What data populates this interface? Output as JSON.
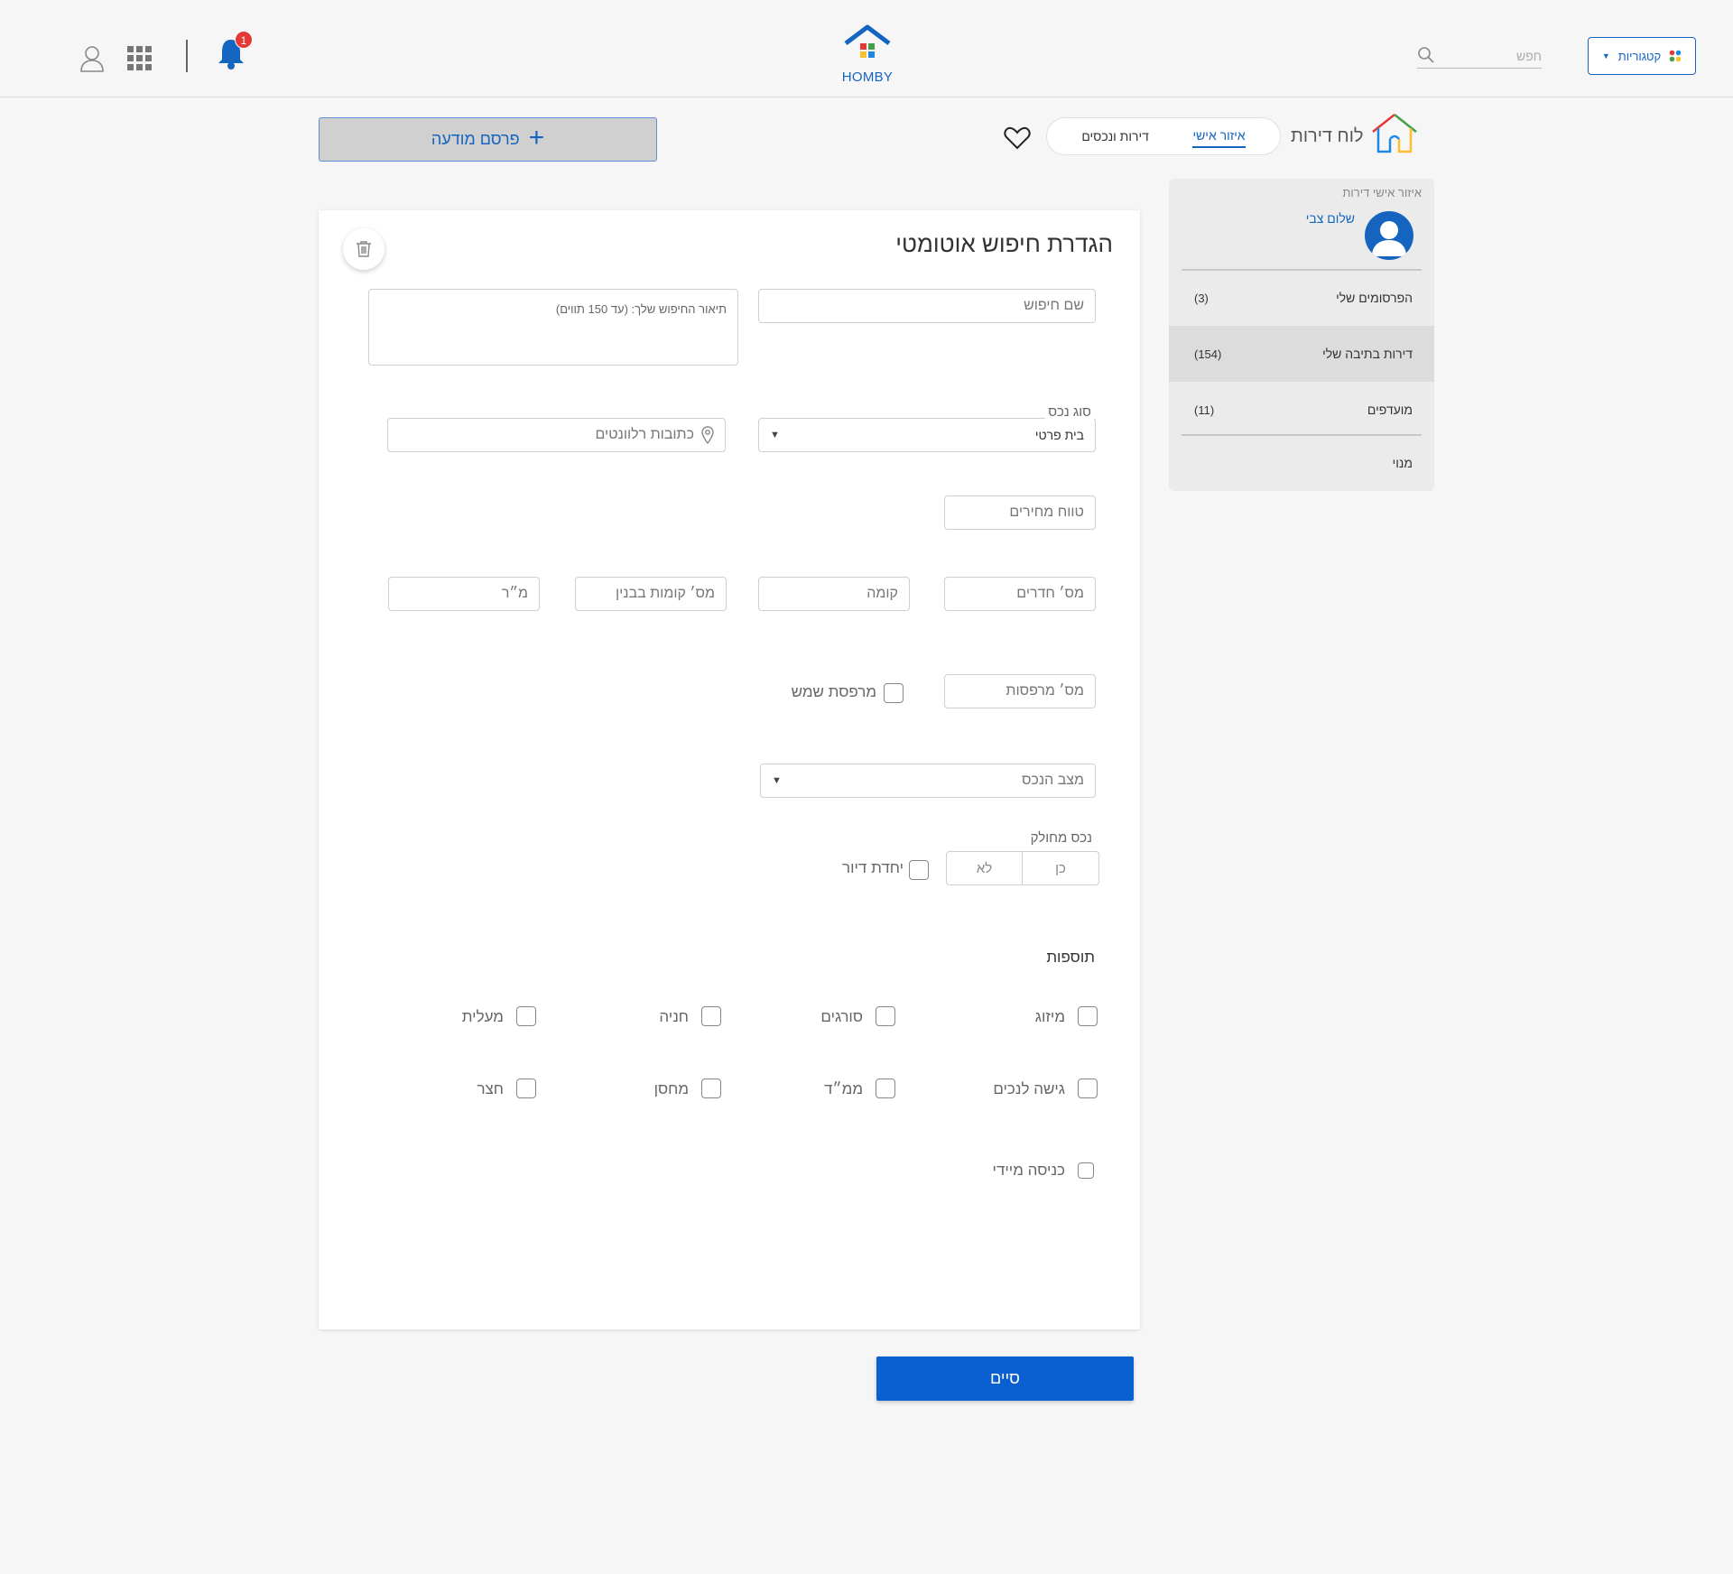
{
  "header": {
    "categories_label": "קטגוריות",
    "search_placeholder": "חפש",
    "logo_text": "HOMBY",
    "notifications_count": "1",
    "icons": [
      "categories-dots-icon",
      "search-icon",
      "home-logo-icon",
      "bell-icon",
      "apps-grid-icon",
      "user-icon"
    ]
  },
  "subheader": {
    "brand_title": "לוח דירות",
    "tabs": [
      {
        "label": "דירות ונכסים",
        "active": false
      },
      {
        "label": "איזור אישי",
        "active": true
      }
    ],
    "publish_label": "פרסם מודעה"
  },
  "sidebar": {
    "title": "איזור אישי דירות",
    "user_name": "שלום צבי",
    "items": [
      {
        "label": "הפרסומים שלי",
        "count": "(3)",
        "active": false
      },
      {
        "label": "דירות בתיבה שלי",
        "count": "(154)",
        "active": true
      },
      {
        "label": "מועדפים",
        "count": "(11)",
        "active": false
      },
      {
        "label": "מנוי",
        "count": "",
        "active": false
      }
    ]
  },
  "form": {
    "title": "הגדרת חיפוש אוטומטי",
    "search_name_placeholder": "שם חיפוש",
    "description_placeholder": "תיאור החיפוש שלך: (עד 150 תווים)",
    "property_type_label": "סוג נכס",
    "property_type_value": "בית פרטי",
    "addresses_placeholder": "כתובות רלוונטים",
    "price_range_placeholder": "טווח מחירים",
    "rooms_placeholder": "מס׳ חדרים",
    "floor_placeholder": "קומה",
    "building_floors_placeholder": "מס׳ קומות בבנין",
    "sqm_placeholder": "מ״ר",
    "balconies_placeholder": "מס׳ מרפסות",
    "sun_balcony_label": "מרפסת שמש",
    "condition_placeholder": "מצב הנכס",
    "divided_label": "נכס מחולק",
    "divided_yes": "כן",
    "divided_no": "לא",
    "unit_label": "יחדת דיור",
    "extras_title": "תוספות",
    "extras_row1": [
      "מיזוג",
      "סורגים",
      "חניה",
      "מעלית"
    ],
    "extras_row2": [
      "גישה לנכים",
      "ממ״ד",
      "מחסן",
      "חצר"
    ],
    "extras_row3": [
      "כניסה מיידי"
    ]
  },
  "finish_label": "סיים",
  "colors": {
    "accent": "#1565c0",
    "button_primary": "#0a5fd1",
    "badge": "#e53935"
  }
}
